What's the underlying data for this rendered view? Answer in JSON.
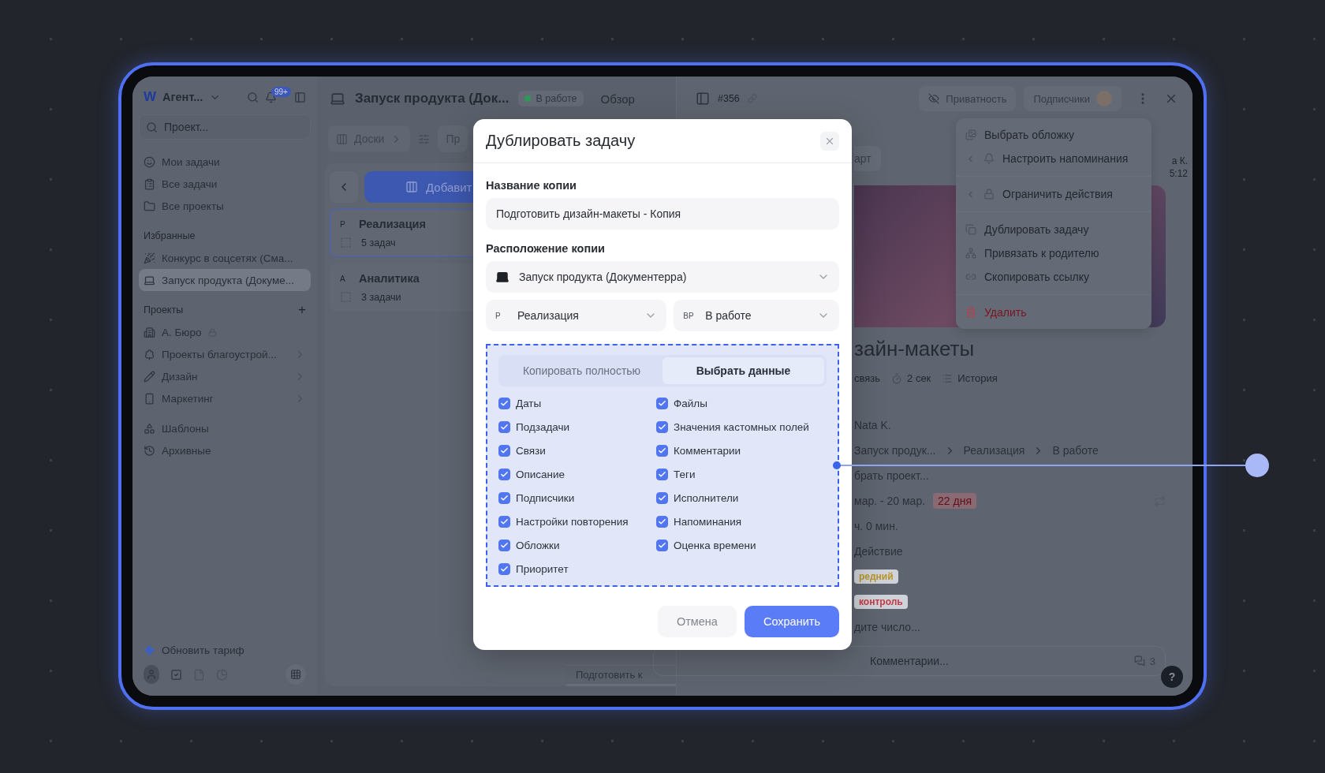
{
  "sidebar": {
    "logo": "W",
    "workspace": "Агент...",
    "badge": "99+",
    "search": {
      "placeholder": "Проект..."
    },
    "nav": [
      "Мои задачи",
      "Все задачи",
      "Все проекты"
    ],
    "favorites": {
      "title": "Избранные",
      "items": [
        {
          "label": "Конкурс в соцсетях (Сма...",
          "selected": false
        },
        {
          "label": "Запуск продукта (Докуме...",
          "selected": true
        }
      ]
    },
    "projects": {
      "title": "Проекты",
      "add": "+",
      "items": [
        {
          "label": "А. Бюро",
          "locked": true,
          "expandable": false
        },
        {
          "label": "Проекты благоустрой...",
          "locked": false,
          "expandable": true
        },
        {
          "label": "Дизайн",
          "locked": false,
          "expandable": true
        },
        {
          "label": "Маркетинг",
          "locked": false,
          "expandable": true
        }
      ]
    },
    "extra": [
      "Шаблоны",
      "Архивные"
    ],
    "upgrade": "Обновить тариф"
  },
  "project_header": {
    "title": "Запуск продукта (Док...",
    "status": {
      "label": "В работе",
      "color": "#2f9a57"
    },
    "view": "Обзор"
  },
  "toolbar": {
    "boards": "Доски",
    "tab": "Пр"
  },
  "board": {
    "add": "Добавит",
    "stages": [
      {
        "prefix": "Р",
        "title": "Реализация",
        "count": "5 задач",
        "selected": true
      },
      {
        "prefix": "А",
        "title": "Аналитика",
        "count": "3 задачи",
        "selected": false
      }
    ],
    "tasks": [
      "Подготовить к"
    ]
  },
  "task_panel": {
    "number": "#356",
    "privacy": "Приватность",
    "subscribers": "Подписчики",
    "cover_button": "арт",
    "meta": [
      "а К.",
      "5:12"
    ],
    "title": "зайн-макеты",
    "stats": [
      "связь",
      "2 сек",
      "История"
    ],
    "fields": [
      {
        "kind": "text",
        "value": "Nata K."
      },
      {
        "kind": "path",
        "parts": [
          "Запуск продук...",
          "Реализация",
          "В работе"
        ]
      },
      {
        "kind": "hint",
        "value": "брать проект..."
      },
      {
        "kind": "dates",
        "value": "мар. - 20 мар.",
        "badge": "22 дня"
      },
      {
        "kind": "text",
        "value": "ч. 0 мин."
      },
      {
        "kind": "text",
        "value": "Действие"
      },
      {
        "kind": "tag",
        "value": "редний",
        "color": "#b8952a"
      },
      {
        "kind": "tag",
        "value": "контроль",
        "color": "#c33a45"
      },
      {
        "kind": "hint",
        "value": "дите число..."
      }
    ],
    "comment": {
      "placeholder": "Комментарии...",
      "count": "3"
    },
    "help": "?"
  },
  "menu": [
    {
      "label": "Выбрать обложку",
      "submenu": false,
      "danger": false,
      "divider_after": false
    },
    {
      "label": "Настроить напоминания",
      "submenu": true,
      "danger": false,
      "divider_after": true
    },
    {
      "label": "Ограничить действия",
      "submenu": true,
      "danger": false,
      "divider_after": true
    },
    {
      "label": "Дублировать задачу",
      "submenu": false,
      "danger": false,
      "divider_after": false
    },
    {
      "label": "Привязать к родителю",
      "submenu": false,
      "danger": false,
      "divider_after": false
    },
    {
      "label": "Скопировать ссылку",
      "submenu": false,
      "danger": false,
      "divider_after": true
    },
    {
      "label": "Удалить",
      "submenu": false,
      "danger": true,
      "divider_after": false
    }
  ],
  "dialog": {
    "title": "Дублировать задачу",
    "name_label": "Название копии",
    "name_value": "Подготовить дизайн-макеты - Копия",
    "location_label": "Расположение копии",
    "project": "Запуск продукта (Документерра)",
    "stage": {
      "prefix": "Р",
      "label": "Реализация"
    },
    "status": {
      "prefix": "ВР",
      "label": "В работе"
    },
    "modes": [
      {
        "label": "Копировать полностью",
        "selected": false
      },
      {
        "label": "Выбрать данные",
        "selected": true
      }
    ],
    "options": [
      {
        "label": "Даты",
        "checked": true
      },
      {
        "label": "Файлы",
        "checked": true
      },
      {
        "label": "Подзадачи",
        "checked": true
      },
      {
        "label": "Значения кастомных полей",
        "checked": true
      },
      {
        "label": "Связи",
        "checked": true
      },
      {
        "label": "Комментарии",
        "checked": true
      },
      {
        "label": "Описание",
        "checked": true
      },
      {
        "label": "Теги",
        "checked": true
      },
      {
        "label": "Подписчики",
        "checked": true
      },
      {
        "label": "Исполнители",
        "checked": true
      },
      {
        "label": "Настройки повторения",
        "checked": true
      },
      {
        "label": "Напоминания",
        "checked": true
      },
      {
        "label": "Обложки",
        "checked": true
      },
      {
        "label": "Оценка времени",
        "checked": true
      },
      {
        "label": "Приоритет",
        "checked": true
      }
    ],
    "cancel": "Отмена",
    "save": "Сохранить"
  }
}
